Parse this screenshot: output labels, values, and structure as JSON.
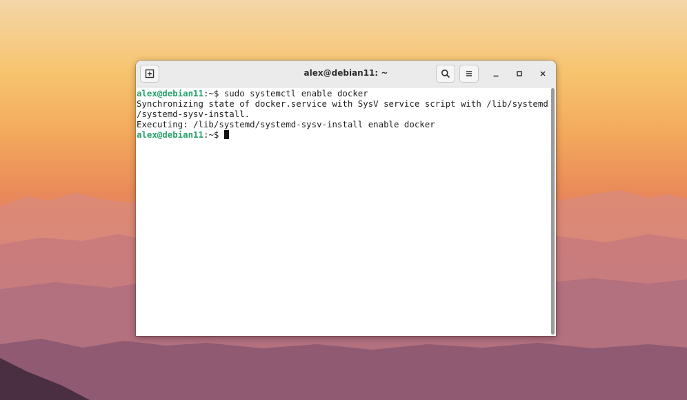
{
  "window": {
    "title": "alex@debian11: ~",
    "buttons": {
      "new_tab_icon": "new-tab-icon",
      "search_icon": "search-icon",
      "menu_icon": "hamburger-menu-icon",
      "minimize_icon": "minimize-icon",
      "maximize_icon": "maximize-icon",
      "close_icon": "close-icon"
    }
  },
  "terminal": {
    "prompt_user": "alex@debian11",
    "prompt_suffix": ":~$ ",
    "command": "sudo systemctl enable docker",
    "output_lines": [
      "Synchronizing state of docker.service with SysV service script with /lib/systemd",
      "/systemd-sysv-install.",
      "Executing: /lib/systemd/systemd-sysv-install enable docker"
    ],
    "colors": {
      "prompt": "#26a269",
      "text": "#1e1e1e",
      "background": "#ffffff"
    }
  }
}
